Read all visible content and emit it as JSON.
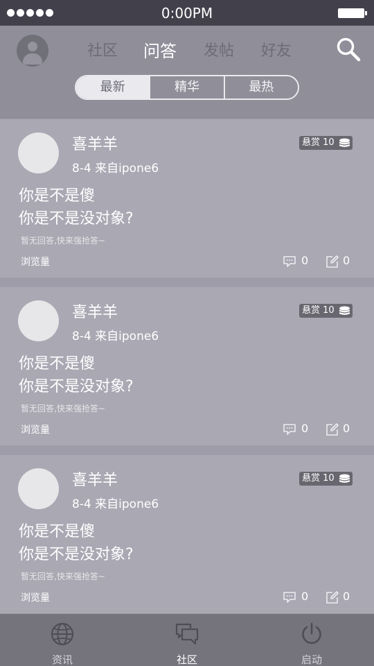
{
  "status_bar": {
    "time": "0:00PM"
  },
  "header": {
    "tabs": [
      {
        "label": "社区"
      },
      {
        "label": "问答",
        "active": true
      },
      {
        "label": "发帖"
      },
      {
        "label": "好友"
      }
    ],
    "segments": [
      {
        "label": "最新",
        "active": true
      },
      {
        "label": "精华"
      },
      {
        "label": "最热"
      }
    ]
  },
  "feed": [
    {
      "name": "喜羊羊",
      "meta": "8-4  来自ipone6",
      "reward": "悬赏 10",
      "line1": "你是不是傻",
      "line2": "你是不是没对象?",
      "hint": "暂无回答,快来强抢答~",
      "views_label": "浏览量",
      "comments": "0",
      "edits": "0"
    },
    {
      "name": "喜羊羊",
      "meta": "8-4  来自ipone6",
      "reward": "悬赏 10",
      "line1": "你是不是傻",
      "line2": "你是不是没对象?",
      "hint": "暂无回答,快来强抢答~",
      "views_label": "浏览量",
      "comments": "0",
      "edits": "0"
    },
    {
      "name": "喜羊羊",
      "meta": "8-4  来自ipone6",
      "reward": "悬赏 10",
      "line1": "你是不是傻",
      "line2": "你是不是没对象?",
      "hint": "暂无回答,快来强抢答~",
      "views_label": "浏览量",
      "comments": "0",
      "edits": "0"
    }
  ],
  "tabbar": {
    "items": [
      {
        "label": "资讯",
        "icon": "globe-icon"
      },
      {
        "label": "社区",
        "icon": "chat-bubbles-icon",
        "active": true
      },
      {
        "label": "启动",
        "icon": "power-icon"
      }
    ]
  },
  "colors": {
    "status_bar": "#42414b",
    "header": "#8f8e99",
    "card": "#a9a8b3",
    "separator": "#9d9ca8",
    "tabbar": "#75747d",
    "active_segment": "#e9e9ee"
  }
}
